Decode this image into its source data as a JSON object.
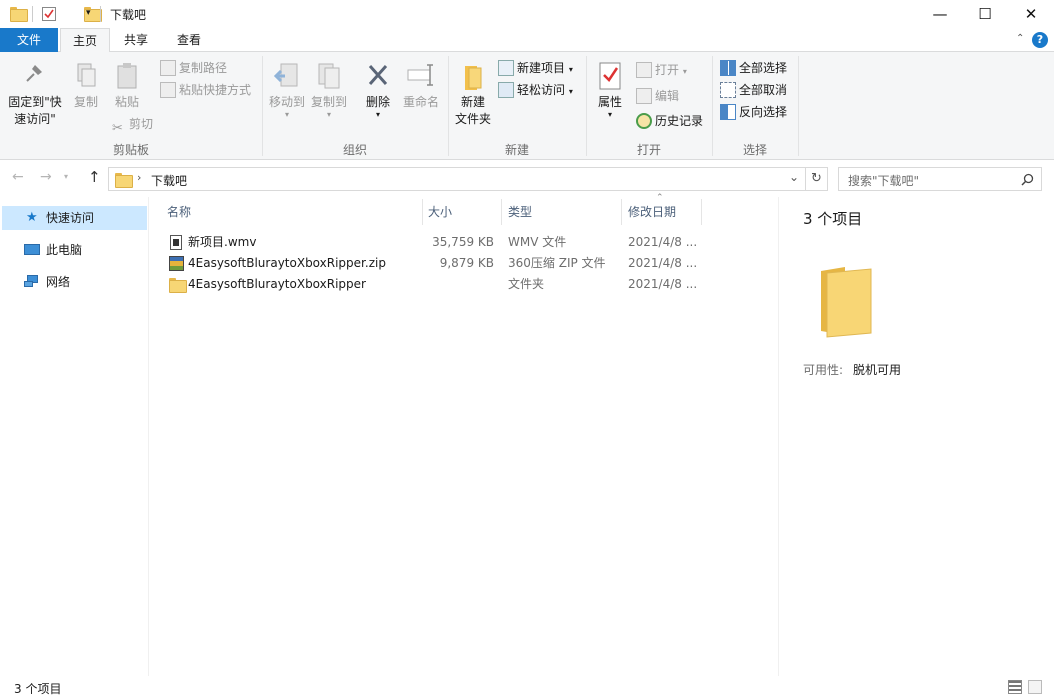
{
  "window": {
    "title": "下载吧",
    "controls": {
      "minimize": "—",
      "maximize": "☐",
      "close": "✕"
    }
  },
  "ribbon_tabs": [
    "文件",
    "主页",
    "共享",
    "查看"
  ],
  "ribbon": {
    "clipboard": {
      "pin_label_1": "固定到\"快",
      "pin_label_2": "速访问\"",
      "copy": "复制",
      "paste": "粘贴",
      "copy_path": "复制路径",
      "paste_shortcut": "粘贴快捷方式",
      "cut": "剪切",
      "group": "剪贴板"
    },
    "organize": {
      "move_to": "移动到",
      "copy_to": "复制到",
      "delete": "删除",
      "rename": "重命名",
      "group": "组织"
    },
    "new": {
      "new_folder_1": "新建",
      "new_folder_2": "文件夹",
      "new_item": "新建项目",
      "easy_access": "轻松访问",
      "group": "新建"
    },
    "open": {
      "properties": "属性",
      "open": "打开",
      "edit": "编辑",
      "history": "历史记录",
      "group": "打开"
    },
    "select": {
      "select_all": "全部选择",
      "select_none": "全部取消",
      "invert": "反向选择",
      "group": "选择"
    }
  },
  "address": {
    "path": "下载吧",
    "search_placeholder": "搜索\"下载吧\""
  },
  "sidebar": {
    "items": [
      {
        "label": "快速访问",
        "icon": "star-icon",
        "selected": true
      },
      {
        "label": "此电脑",
        "icon": "computer-icon",
        "selected": false
      },
      {
        "label": "网络",
        "icon": "network-icon",
        "selected": false
      }
    ]
  },
  "file_list": {
    "columns": [
      "名称",
      "大小",
      "类型",
      "修改日期"
    ],
    "rows": [
      {
        "name": "新项目.wmv",
        "size": "35,759 KB",
        "type": "WMV 文件",
        "date": "2021/4/8 ...",
        "icon": "video-file-icon"
      },
      {
        "name": "4EasysoftBluraytoXboxRipper.zip",
        "size": "9,879 KB",
        "type": "360压缩 ZIP 文件",
        "date": "2021/4/8 ...",
        "icon": "zip-file-icon"
      },
      {
        "name": "4EasysoftBluraytoXboxRipper",
        "size": "",
        "type": "文件夹",
        "date": "2021/4/8 ...",
        "icon": "folder-icon"
      }
    ]
  },
  "preview": {
    "count": "3 个项目",
    "availability_label": "可用性:",
    "availability_value": "脱机可用"
  },
  "status": {
    "count": "3 个项目"
  },
  "colors": {
    "accent": "#1979ca",
    "selection": "#cce8ff",
    "ribbon_bg": "#f5f6f7"
  }
}
